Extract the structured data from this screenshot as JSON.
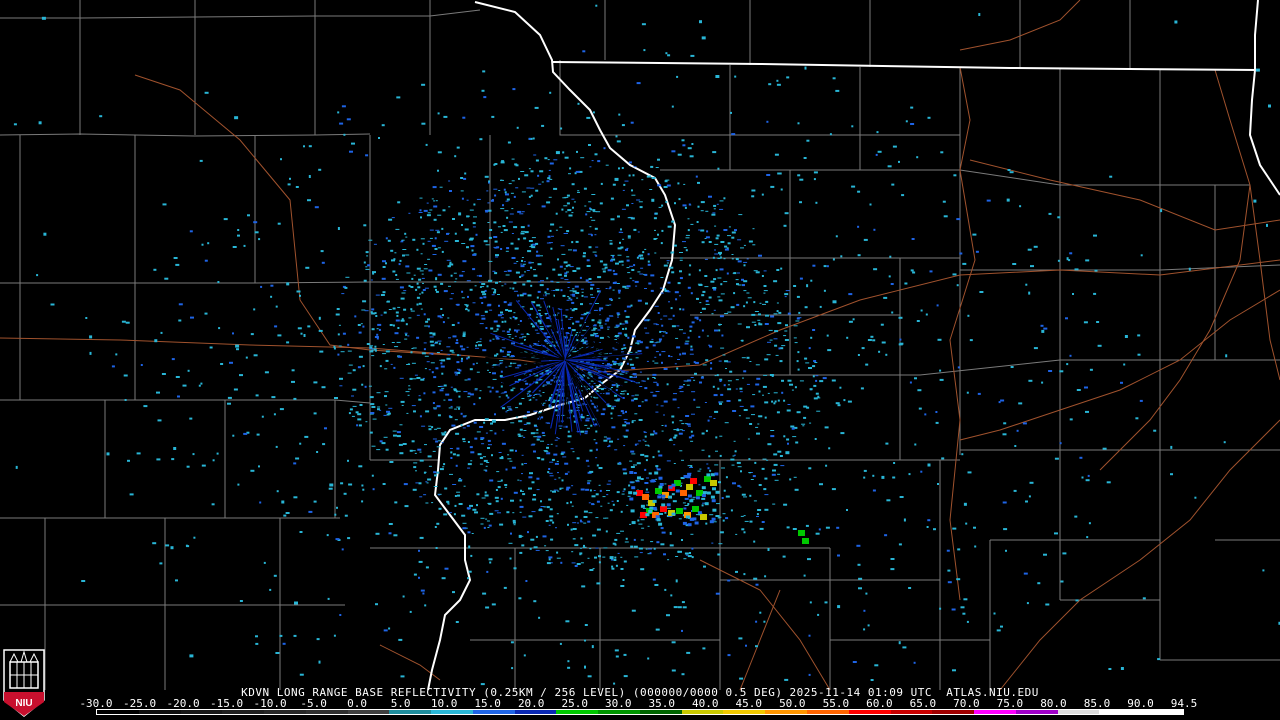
{
  "caption": "KDVN LONG RANGE BASE REFLECTIVITY (0.25KM / 256 LEVEL) (000000/0000 0.5 DEG) 2025-11-14 01:09 UTC  ATLAS.NIU.EDU",
  "logo_text": "NIU",
  "scale_labels": [
    "-30.0",
    "-25.0",
    "-20.0",
    "-15.0",
    "-10.0",
    "-5.0",
    "0.0",
    "5.0",
    "10.0",
    "15.0",
    "20.0",
    "25.0",
    "30.0",
    "35.0",
    "40.0",
    "45.0",
    "50.0",
    "55.0",
    "60.0",
    "65.0",
    "70.0",
    "75.0",
    "80.0",
    "85.0",
    "90.0",
    "94.5"
  ],
  "colors": {
    "background": "#000000",
    "county_lines": "#7a7a7a",
    "state_lines": "#ffffff",
    "roads": "#a0522d",
    "radar_light": "#29b6d6",
    "radar_mid": "#1e64e6",
    "radar_dark": "#0a28b4",
    "logo_red": "#c8102e"
  },
  "colorbar": [
    "#000000",
    "#101010",
    "#181818",
    "#202020",
    "#282828",
    "#303030",
    "#404040",
    "#1e8c9c",
    "#29b6d6",
    "#1e64e6",
    "#0a28b4",
    "#00c800",
    "#009600",
    "#006400",
    "#c8c800",
    "#f0c800",
    "#ff9600",
    "#ff6400",
    "#ff0000",
    "#c80000",
    "#a00000",
    "#ff00ff",
    "#a000c8",
    "#dcdcdc",
    "#ffffff",
    "#ffffff"
  ]
}
